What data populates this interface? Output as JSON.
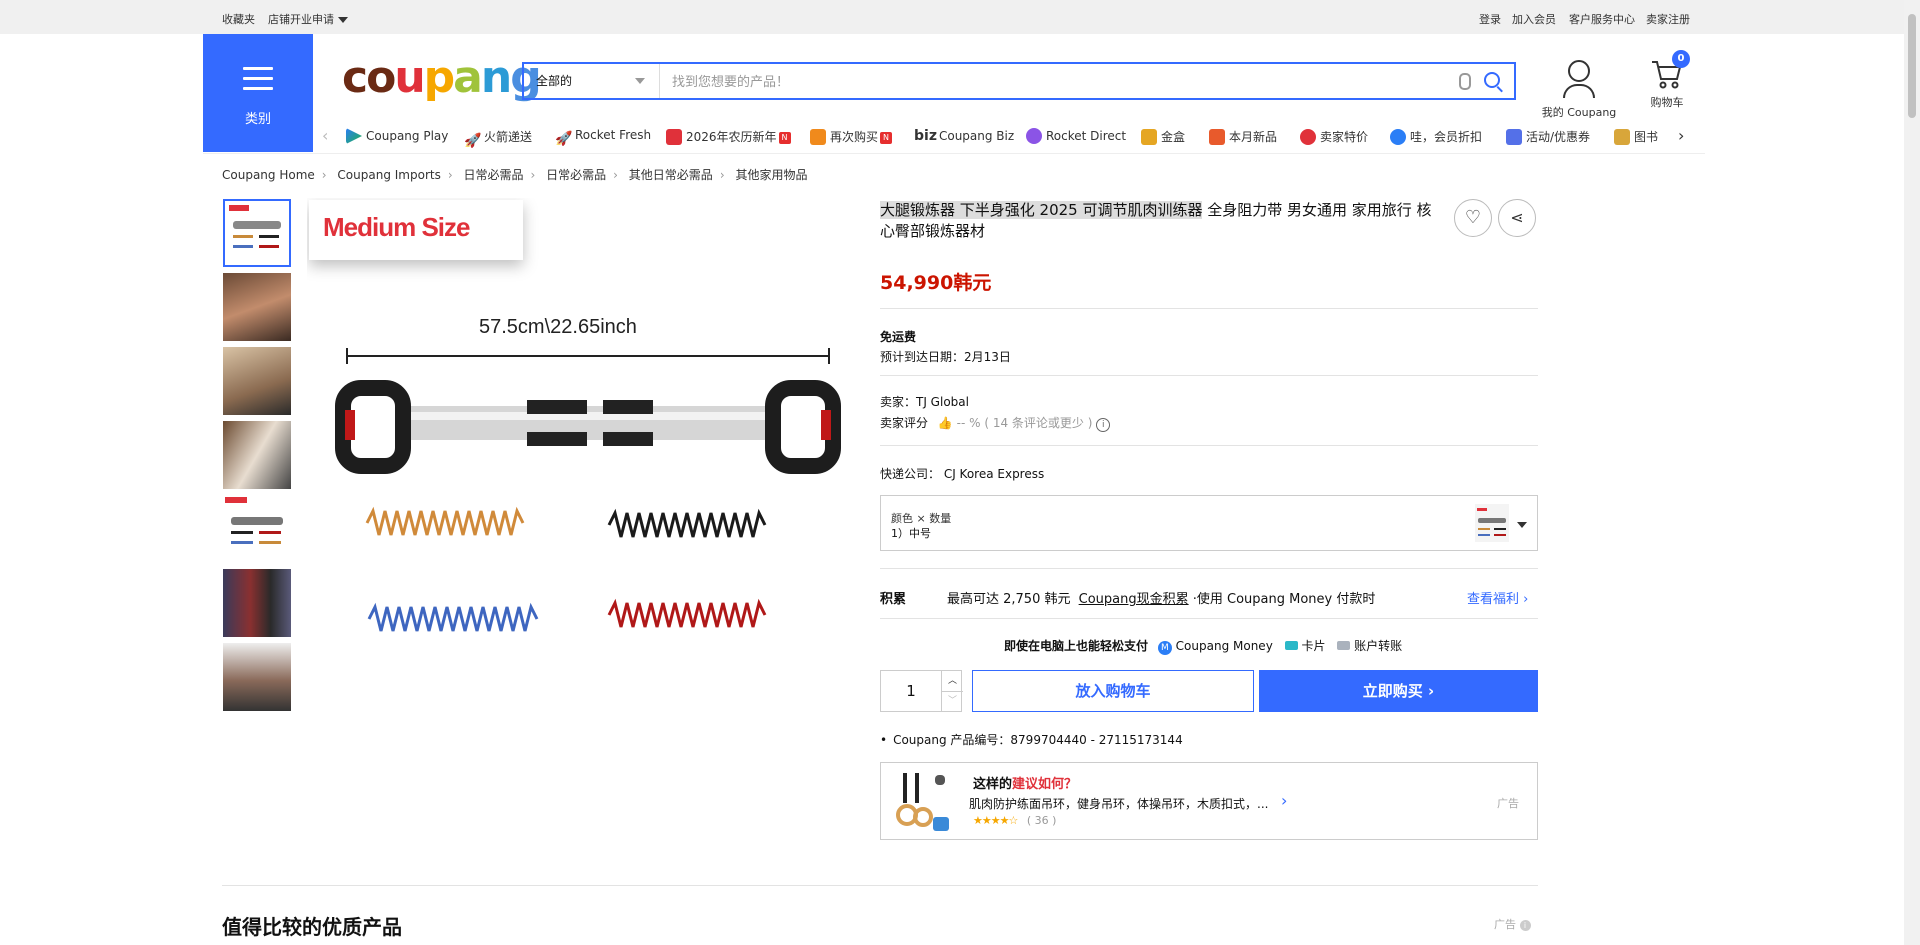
{
  "topbar": {
    "favorites": "收藏夹",
    "store_apply": "店铺开业申请",
    "login": "登录",
    "join": "加入会员",
    "customer_service": "客户服务中心",
    "seller_signup": "卖家注册"
  },
  "category_button": {
    "label": "类别"
  },
  "logo": {
    "text": "coupang"
  },
  "search": {
    "category_value": "全部的",
    "placeholder": "找到您想要的产品！"
  },
  "account": {
    "label": "我的 Coupang"
  },
  "cart": {
    "label": "购物车",
    "count": "0"
  },
  "nav_items": [
    {
      "label": "Coupang Play",
      "icon": "play-icon",
      "color": "#2b7ef6"
    },
    {
      "label": "火箭递送",
      "icon": "rocket-icon",
      "color": "#346aff"
    },
    {
      "label": "Rocket Fresh",
      "icon": "fresh-rocket-icon",
      "color": "#1db34b"
    },
    {
      "label": "2026年农历新年",
      "icon": "gift-icon",
      "color": "#e0313a",
      "badge": "N"
    },
    {
      "label": "再次购买",
      "icon": "rebuy-icon",
      "color": "#f08a1c",
      "badge": "N"
    },
    {
      "label": "Coupang Biz",
      "icon": "biz-icon",
      "color": "#333333",
      "prefix": "biz"
    },
    {
      "label": "Rocket Direct",
      "icon": "direct-icon",
      "color": "#8b54e6"
    },
    {
      "label": "金盒",
      "icon": "gold-box-icon",
      "color": "#e5a623"
    },
    {
      "label": "本月新品",
      "icon": "new-icon",
      "color": "#e85a2c"
    },
    {
      "label": "卖家特价",
      "icon": "discount-icon",
      "color": "#e0313a"
    },
    {
      "label": "哇，会员折扣",
      "icon": "wow-icon",
      "color": "#2b7ef6"
    },
    {
      "label": "活动/优惠券",
      "icon": "coupon-icon",
      "color": "#5470e8"
    },
    {
      "label": "图书",
      "icon": "book-icon",
      "color": "#d8a63a"
    }
  ],
  "breadcrumb": [
    "Coupang Home",
    "Coupang Imports",
    "日常必需品",
    "日常必需品",
    "其他日常必需品",
    "其他家用物品"
  ],
  "product_image": {
    "size_label": "Medium Size",
    "dimension_label": "57.5cm\\22.65inch"
  },
  "product": {
    "title_highlight": "大腿锻炼器 下半身强化 2025 可调节肌肉训练器",
    "title_rest": " 全身阻力带 男女通用 家用旅行 核心臀部锻炼器材",
    "price": "54,990韩元",
    "shipping": "免运费",
    "delivery": "预计到达日期：2月13日",
    "seller": "卖家：TJ Global",
    "seller_rating_label": "卖家评分",
    "seller_rating_value": "-- %",
    "seller_rating_count": "( 14 条评论或更少 )",
    "courier": "快递公司：  CJ Korea Express",
    "option_label": "颜色 × 数量",
    "option_value": "1）中号",
    "reward_label": "积累",
    "reward_text_1": "最高可达 2,750 韩元",
    "reward_link": "Coupang现金积累",
    "reward_text_2": "·使用 Coupang Money 付款时",
    "reward_more": "查看福利",
    "pay_note": "即使在电脑上也能轻松支付",
    "pay_method_1": "Coupang Money",
    "pay_method_2": "卡片",
    "pay_method_3": "账户转账",
    "quantity": "1",
    "add_to_cart": "放入购物车",
    "buy_now": "立即购买",
    "product_code": "Coupang 产品编号：8799704440 - 27115173144"
  },
  "ad": {
    "title_1": "这样的",
    "title_highlight": "建议如何？",
    "description": "肌肉防护练面吊环，健身吊环，体操吊环，木质扣式，...",
    "reviews": "( 36 )",
    "rating": 4.5,
    "ad_label": "广告"
  },
  "section": {
    "title": "值得比较的优质产品",
    "ad_label": "广告"
  },
  "colors": {
    "accent": "#346aff",
    "price": "#cb1400",
    "rating_star": "#f6a700"
  }
}
